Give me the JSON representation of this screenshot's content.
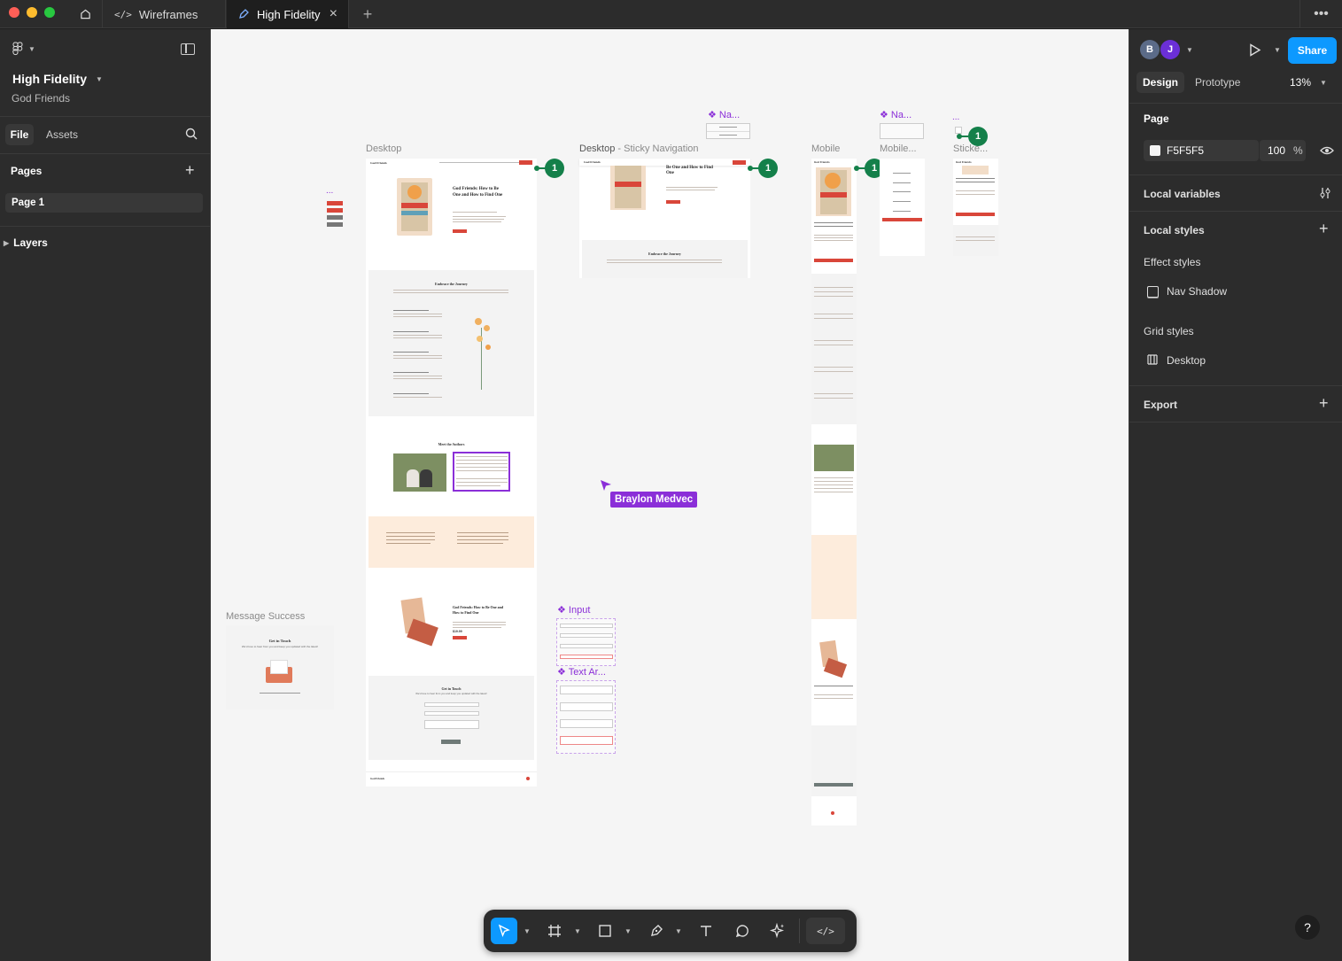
{
  "titlebar": {
    "tabs": [
      {
        "label": "Wireframes",
        "icon": "code-icon"
      },
      {
        "label": "High Fidelity",
        "icon": "pen-icon"
      }
    ]
  },
  "left_panel": {
    "file_title": "High Fidelity",
    "project_name": "God Friends",
    "tab_file": "File",
    "tab_assets": "Assets",
    "pages_heading": "Pages",
    "pages": [
      "Page 1"
    ],
    "layers_heading": "Layers"
  },
  "right_panel": {
    "avatars": [
      "B",
      "J"
    ],
    "share_label": "Share",
    "tab_design": "Design",
    "tab_prototype": "Prototype",
    "zoom": "13%",
    "page_heading": "Page",
    "page_color": "F5F5F5",
    "page_opacity": "100",
    "percent": "%",
    "local_variables": "Local variables",
    "local_styles": "Local styles",
    "effect_styles": "Effect styles",
    "effect_style_item": "Nav Shadow",
    "grid_styles": "Grid styles",
    "grid_style_item": "Desktop",
    "export": "Export"
  },
  "canvas": {
    "frames": {
      "desktop": "Desktop",
      "sticky_a": "Desktop",
      "sticky_b": " - Sticky Navigation",
      "mobile": "Mobile",
      "mobile2": "Mobile...",
      "sticky2": "Sticke...",
      "message_success": "Message Success"
    },
    "components": {
      "nav1": "Na...",
      "nav2": "Na...",
      "dots": "...",
      "input": "Input",
      "text_area": "Text Ar..."
    },
    "badge": "1",
    "cursor_user": "Braylon Medvec",
    "desktop_content": {
      "brand": "God Friends",
      "hero_title": "God Friends: How to Be One and How to Find One",
      "sec_journey": "Embrace the Journey",
      "sec_authors": "Meet the Authors",
      "sec_book": "God Friends: How to Be One and How to Find One",
      "price": "$19.99",
      "sec_contact": "Get in Touch",
      "contact_sub": "We'd love to hear from you and keep you updated with the latest!"
    },
    "message_card": {
      "title": "Get in Touch",
      "subtitle": "We'd love to hear from you and keep you updated with the latest!"
    }
  },
  "help": "?"
}
